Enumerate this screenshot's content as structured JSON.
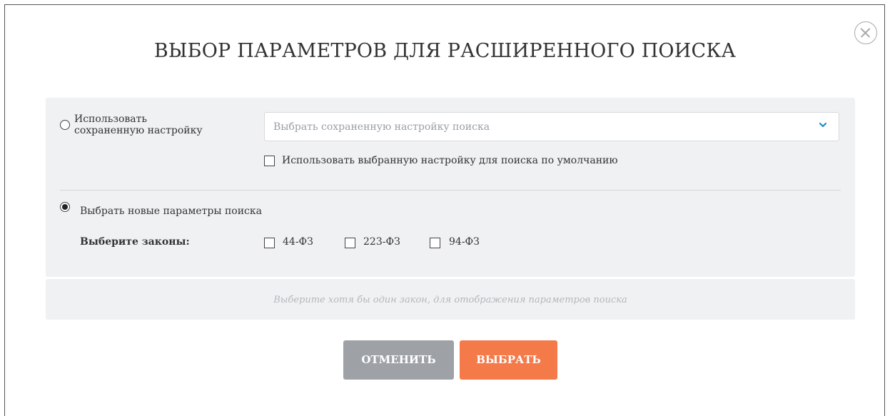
{
  "dialog": {
    "title": "ВЫБОР ПАРАМЕТРОВ ДЛЯ РАСШИРЕННОГО ПОИСКА",
    "close_icon": "close-circle-icon"
  },
  "saved": {
    "radio_label_line1": "Использовать",
    "radio_label_line2": "сохраненную настройку",
    "selected": false,
    "select_placeholder": "Выбрать сохраненную настройку поиска",
    "default_checkbox_label": "Использовать выбранную настройку для поиска по умолчанию",
    "default_checked": false,
    "accent_color": "#1a8ccf"
  },
  "new_params": {
    "radio_label": "Выбрать новые параметры поиска",
    "selected": true,
    "laws_label": "Выберите законы:",
    "laws": [
      {
        "label": "44-ФЗ",
        "checked": false
      },
      {
        "label": "223-ФЗ",
        "checked": false
      },
      {
        "label": "94-ФЗ",
        "checked": false
      }
    ]
  },
  "hint": "Выберите хотя бы один закон, для отображения параметров поиска",
  "buttons": {
    "cancel": "ОТМЕНИТЬ",
    "cancel_color": "#9ea2a7",
    "select": "ВЫБРАТЬ",
    "select_color": "#f47a4a"
  }
}
